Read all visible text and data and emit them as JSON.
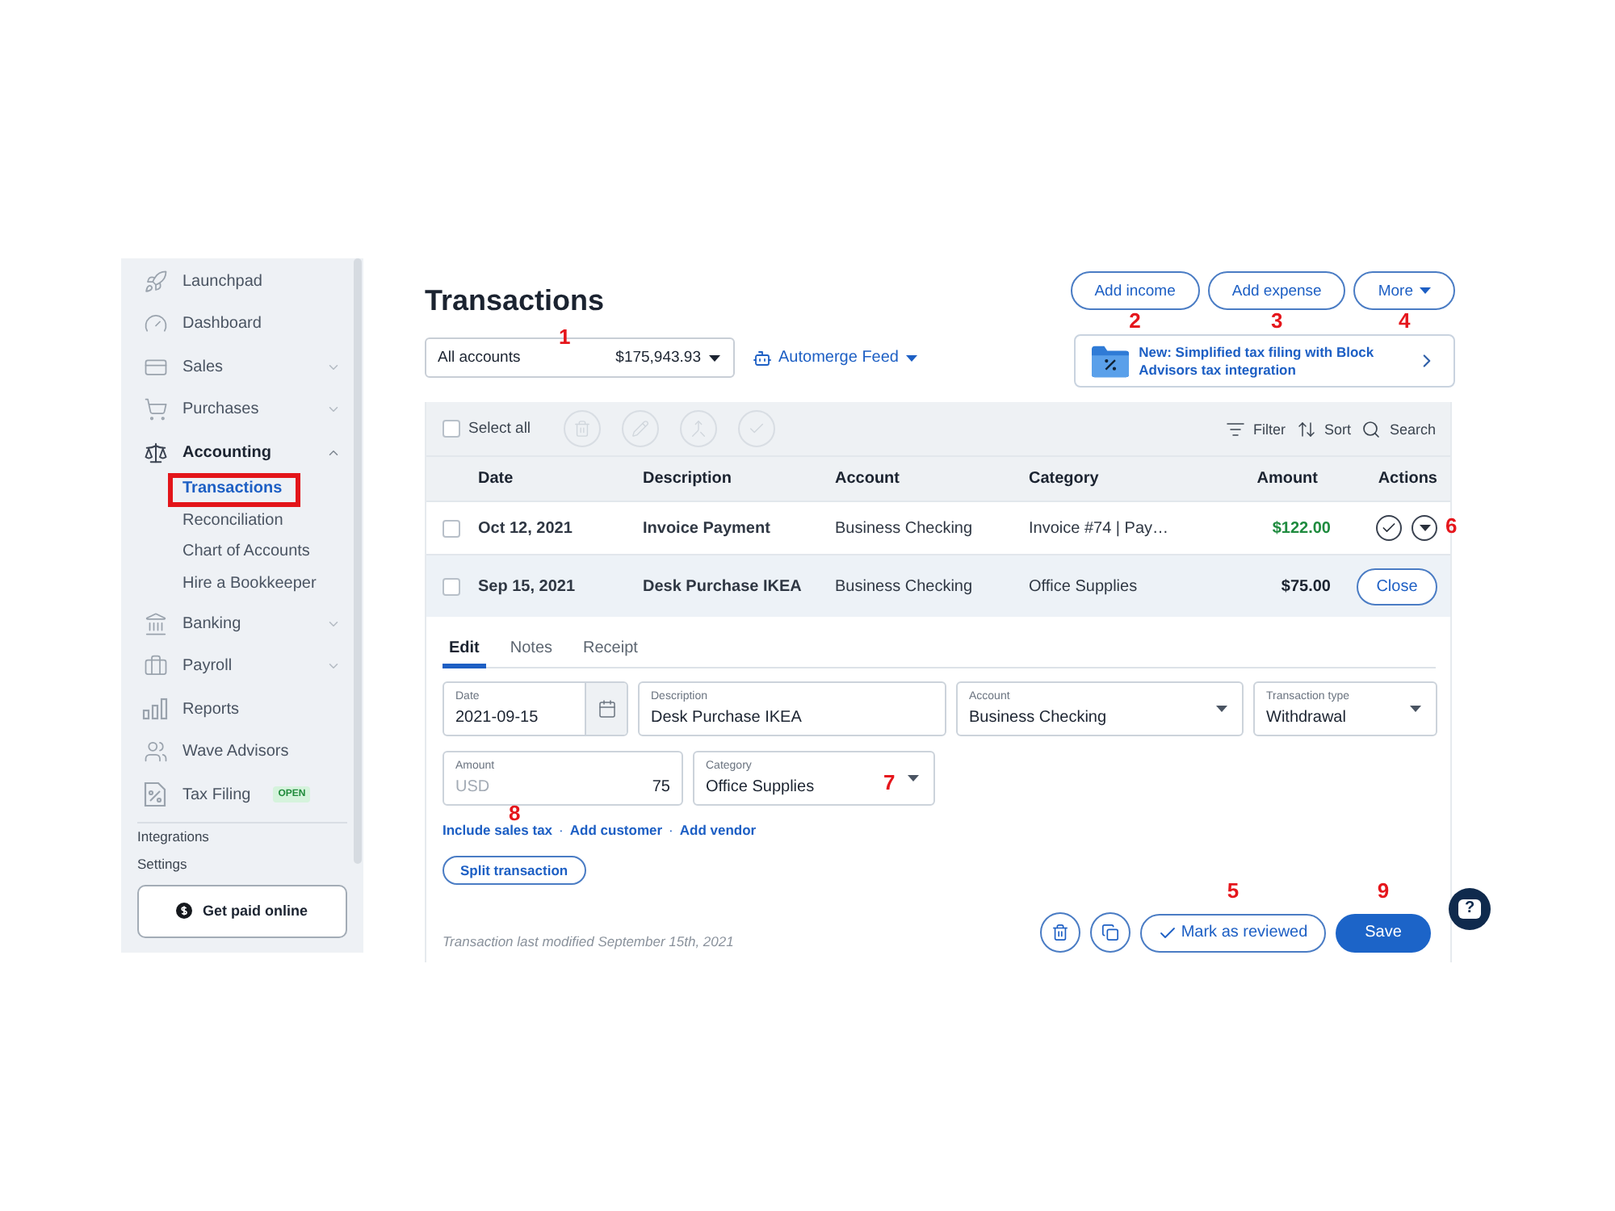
{
  "sidebar": {
    "items": [
      {
        "label": "Launchpad",
        "selected": false
      },
      {
        "label": "Dashboard",
        "selected": false
      },
      {
        "label": "Sales",
        "selected": false,
        "expanded": false
      },
      {
        "label": "Purchases",
        "selected": false,
        "expanded": false
      },
      {
        "label": "Accounting",
        "selected": true,
        "expanded": true,
        "children": [
          {
            "label": "Transactions",
            "selected": true,
            "highlighted": true
          },
          {
            "label": "Reconciliation",
            "selected": false,
            "highlighted": false
          },
          {
            "label": "Chart of Accounts",
            "selected": false,
            "highlighted": false
          },
          {
            "label": "Hire a Bookkeeper",
            "selected": false,
            "highlighted": false
          }
        ]
      },
      {
        "label": "Banking",
        "selected": false,
        "expanded": false
      },
      {
        "label": "Payroll",
        "selected": false,
        "expanded": false
      },
      {
        "label": "Reports",
        "selected": false
      },
      {
        "label": "Wave Advisors",
        "selected": false
      },
      {
        "label": "Tax Filing",
        "selected": false,
        "badge": "OPEN"
      }
    ],
    "links": [
      "Integrations",
      "Settings"
    ],
    "cta": "Get paid online"
  },
  "page": {
    "title": "Transactions"
  },
  "account_filter": {
    "label": "All accounts",
    "balance": "$175,943.93",
    "callout": "1"
  },
  "feed_menu": {
    "label": "Automerge Feed"
  },
  "header_buttons": [
    {
      "label": "Add income",
      "kind": "button",
      "callout": "2"
    },
    {
      "label": "Add expense",
      "kind": "button",
      "callout": "3"
    },
    {
      "label": "More",
      "kind": "menu",
      "callout": "4"
    }
  ],
  "banner": {
    "text": "New: Simplified tax filing with Block Advisors tax integration"
  },
  "toolbar": {
    "select_all": {
      "label": "Select all",
      "checked": false
    },
    "bulk_actions": [
      {
        "kind": "delete",
        "disabled": true
      },
      {
        "kind": "edit",
        "disabled": true
      },
      {
        "kind": "merge",
        "disabled": true
      },
      {
        "kind": "review",
        "disabled": true
      }
    ],
    "tools": [
      {
        "kind": "filter",
        "label": "Filter"
      },
      {
        "kind": "sort",
        "label": "Sort"
      },
      {
        "kind": "search",
        "label": "Search"
      }
    ]
  },
  "table": {
    "columns": [
      "Date",
      "Description",
      "Account",
      "Category",
      "Amount",
      "Actions"
    ],
    "rows": [
      {
        "checked": false,
        "date": "Oct 12, 2021",
        "description": "Invoice Payment",
        "account": "Business Checking",
        "category": "Invoice #74 | Pay…",
        "amount": "$122.00",
        "kind": "deposit",
        "expanded": false,
        "callout": "6"
      },
      {
        "checked": false,
        "date": "Sep 15, 2021",
        "description": "Desk Purchase IKEA",
        "account": "Business Checking",
        "category": "Office Supplies",
        "amount": "$75.00",
        "kind": "withdrawal",
        "expanded": true,
        "close_label": "Close"
      }
    ]
  },
  "editor": {
    "tabs": [
      {
        "label": "Edit",
        "selected": true
      },
      {
        "label": "Notes",
        "selected": false
      },
      {
        "label": "Receipt",
        "selected": false
      }
    ],
    "field_rows": [
      [
        {
          "kind": "date",
          "label": "Date",
          "value": "2021-09-15"
        },
        {
          "kind": "text",
          "label": "Description",
          "value": "Desk Purchase IKEA"
        },
        {
          "kind": "select",
          "label": "Account",
          "value": "Business Checking"
        },
        {
          "kind": "select",
          "label": "Transaction type",
          "value": "Withdrawal"
        }
      ],
      [
        {
          "kind": "amount",
          "label": "Amount",
          "currency": "USD",
          "value": "75"
        },
        {
          "kind": "select",
          "label": "Category",
          "value": "Office Supplies",
          "callout": "7"
        }
      ]
    ],
    "links": {
      "items": [
        "Include sales tax",
        "Add customer",
        "Add vendor"
      ],
      "separator": "·",
      "callout": "8"
    },
    "split_button": "Split transaction",
    "modified_note": "Transaction last modified September 15th, 2021",
    "actions": [
      {
        "kind": "delete"
      },
      {
        "kind": "duplicate"
      },
      {
        "kind": "review",
        "label": "Mark as reviewed",
        "callout": "5"
      },
      {
        "kind": "save",
        "label": "Save",
        "callout": "9"
      }
    ]
  },
  "help_button": {
    "label": "?"
  }
}
